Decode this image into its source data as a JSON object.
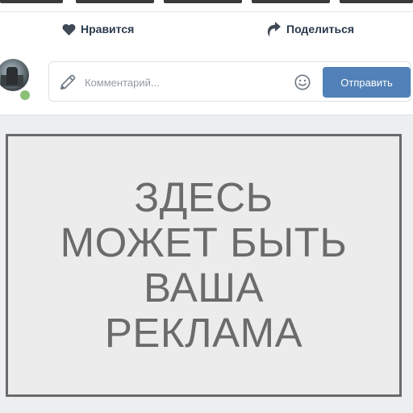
{
  "actions": {
    "like_label": "Нравится",
    "share_label": "Поделиться"
  },
  "comment": {
    "placeholder": "Комментарий...",
    "send_label": "Отправить"
  },
  "ad": {
    "lines": [
      "ЗДЕСЬ",
      "МОЖЕТ БЫТЬ",
      "ВАША",
      "РЕКЛАМА"
    ]
  },
  "colors": {
    "accent": "#5181b8",
    "online": "#8ac176",
    "ad_text": "#6b6b6b",
    "feed_bg": "#edeef0"
  }
}
